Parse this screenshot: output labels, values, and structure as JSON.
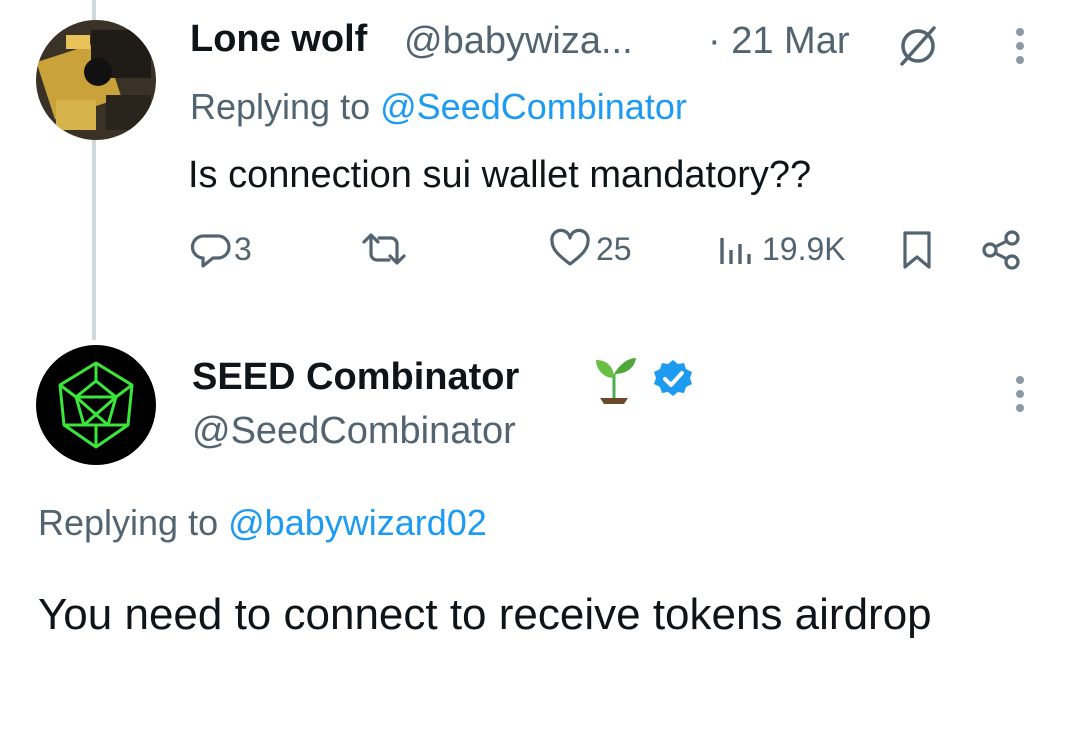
{
  "tweet1": {
    "name": "Lone wolf",
    "handle": "@babywiza...",
    "date": "· 21 Mar",
    "replying_prefix": "Replying to",
    "replying_handle": "@SeedCombinator",
    "text": "Is connection sui wallet mandatory??",
    "stats": {
      "replies": "3",
      "likes": "25",
      "views": "19.9K"
    }
  },
  "tweet2": {
    "name": "SEED Combinator",
    "emoji": "🌱",
    "handle": "@SeedCombinator",
    "replying_prefix": "Replying to",
    "replying_handle": "@babywizard02",
    "text": "You need to connect to receive tokens airdrop"
  },
  "colors": {
    "link": "#1d9bf0",
    "muted": "#536471",
    "text": "#0f1419",
    "thread_line": "#cfd9de",
    "verified": "#1d9bf0",
    "logo_green": "#39e639"
  },
  "icons": [
    "grok-icon",
    "more-icon",
    "reply-icon",
    "retweet-icon",
    "like-icon",
    "views-icon",
    "bookmark-icon",
    "share-icon",
    "verified-badge-icon",
    "seedling-icon"
  ]
}
